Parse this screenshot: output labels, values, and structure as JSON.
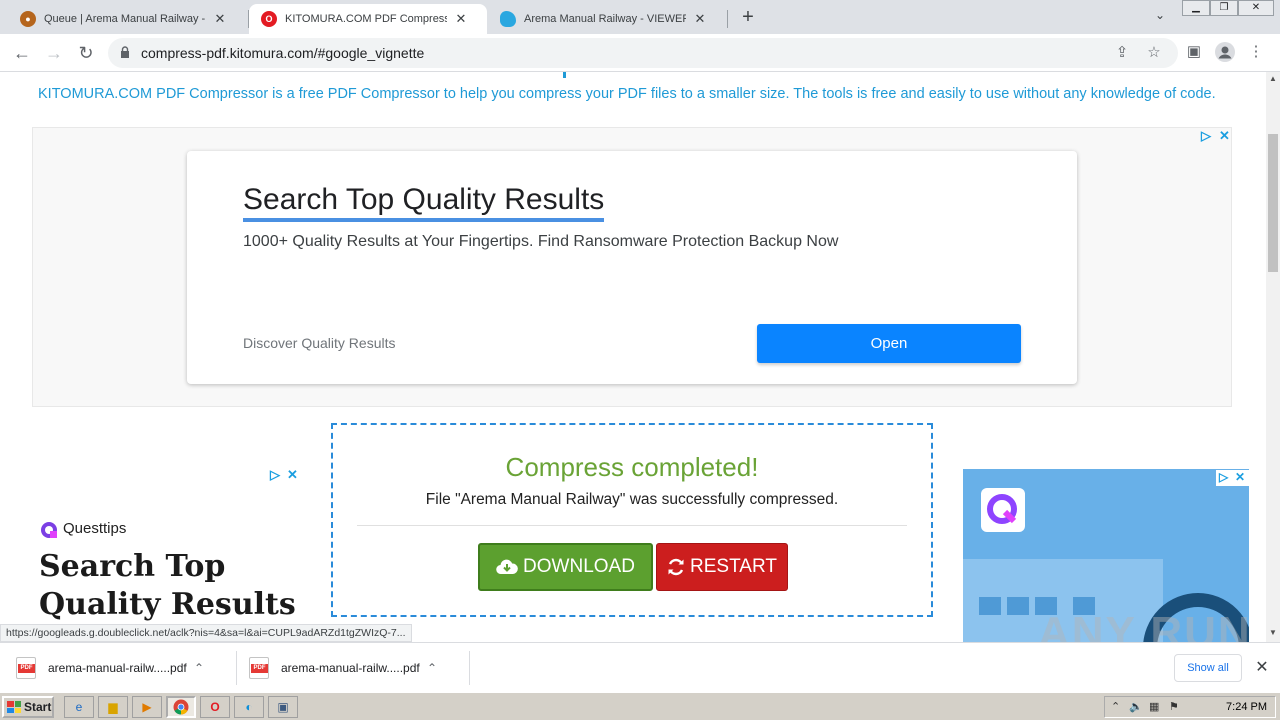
{
  "browser": {
    "tabs": [
      {
        "title": "Queue | Arema Manual Railway - PDF",
        "icon": "blocky-globe-icon",
        "active": false
      },
      {
        "title": "KITOMURA.COM PDF Compressor Online",
        "icon": "opera-icon",
        "active": true
      },
      {
        "title": "Arema Manual Railway - VIEWER XDF",
        "icon": "cloud-icon",
        "active": false
      }
    ],
    "new_tab_label": "+",
    "url": "compress-pdf.kitomura.com/#google_vignette"
  },
  "page": {
    "intro_text": "KITOMURA.COM PDF Compressor is a free PDF Compressor to help you compress your PDF files to a smaller size. The tools is free and easily to use without any knowledge of code.",
    "top_ad": {
      "headline": "Search Top Quality Results",
      "description": "1000+ Quality Results at Your Fingertips. Find Ransomware Protection Backup Now",
      "display_url": "Discover Quality Results",
      "cta": "Open",
      "accent_color": "#0a84ff"
    },
    "result": {
      "title": "Compress completed!",
      "message": "File \"Arema Manual Railway\" was successfully compressed.",
      "download_label": "DOWNLOAD",
      "restart_label": "RESTART",
      "success_color": "#6aa336",
      "download_color": "#5ca02f",
      "restart_color": "#cc1e1e"
    },
    "left_ad": {
      "brand": "Questtips",
      "headline": "Search Top Quality Results"
    }
  },
  "status_bar": {
    "link_url": "https://googleads.g.doubleclick.net/aclk?nis=4&sa=l&ai=CUPL9adARZd1tgZWIzQ-7..."
  },
  "downloads": {
    "items": [
      {
        "name": "arema-manual-railw.....pdf",
        "icon": "pdf-icon"
      },
      {
        "name": "arema-manual-railw.....pdf",
        "icon": "pdf-icon"
      }
    ],
    "show_all_label": "Show all"
  },
  "taskbar": {
    "start_label": "Start",
    "clock": "7:24 PM"
  },
  "watermark": "ANY RUN"
}
